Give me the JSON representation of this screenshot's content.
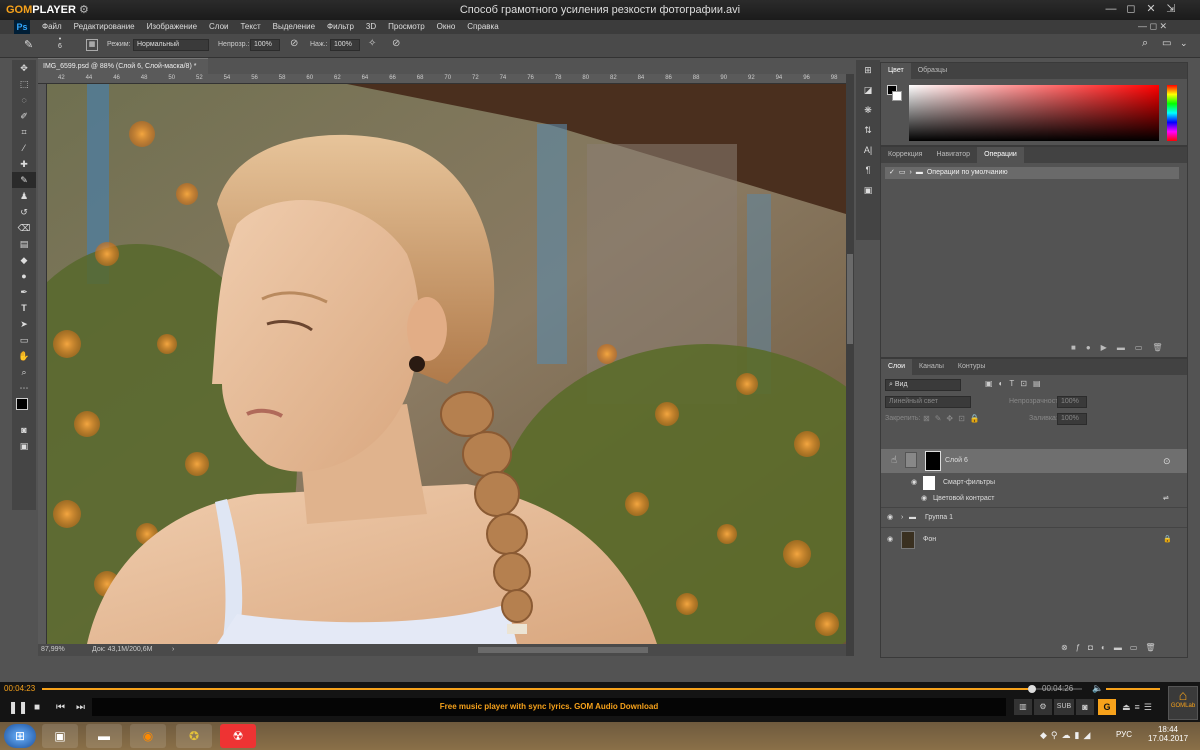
{
  "gom": {
    "logo_a": "GOM",
    "logo_b": "PLAYER",
    "settings_icon": "gear-icon",
    "title": "Способ грамотного усиления резкости фотографии.avi",
    "win_buttons": [
      "—",
      "◻",
      "✕",
      "⇲"
    ]
  },
  "ps": {
    "logo": "Ps",
    "menu": [
      "Файл",
      "Редактирование",
      "Изображение",
      "Слои",
      "Текст",
      "Выделение",
      "Фильтр",
      "3D",
      "Просмотр",
      "Окно",
      "Справка"
    ],
    "options": {
      "brush_size": "6",
      "mode_label": "Режим:",
      "mode_value": "Нормальный",
      "opacity_label": "Непрозр.:",
      "opacity_value": "100%",
      "flow_label": "Наж.:",
      "flow_value": "100%"
    },
    "doc_tab": "IMG_6599.psd @ 88% (Слой 6, Слой-маска/8) *",
    "ruler_ticks": [
      "42",
      "44",
      "46",
      "48",
      "50",
      "52",
      "54",
      "56",
      "58",
      "60",
      "62",
      "64",
      "66",
      "68",
      "70",
      "72",
      "74",
      "76",
      "78",
      "80",
      "82",
      "84",
      "86",
      "88",
      "90",
      "92",
      "94",
      "96",
      "98"
    ],
    "status": {
      "zoom": "87,99%",
      "doc": "Док: 43,1M/200,6M"
    }
  },
  "color_panel": {
    "tabs": [
      "Цвет",
      "Образцы"
    ]
  },
  "actions_panel": {
    "tabs": [
      "Коррекция",
      "Навигатор",
      "Операции"
    ],
    "items": [
      "Операции по умолчанию"
    ]
  },
  "layers_panel": {
    "tabs": [
      "Слои",
      "Каналы",
      "Контуры"
    ],
    "filter": "Вид",
    "blend": "Линейный свет",
    "opacity_label": "Непрозрачность:",
    "opacity_value": "100%",
    "lock_label": "Закрепить:",
    "fill_label": "Заливка:",
    "fill_value": "100%",
    "layers": [
      "Слой 6",
      "Смарт-фильтры",
      "Цветовой контраст",
      "Группа 1",
      "Фон"
    ]
  },
  "player": {
    "time_current": "00:04:23",
    "time_total": "00:04:26",
    "ticker": "Free music player with sync lyrics. GOM Audio Download",
    "buttons": [
      "SUB",
      "G"
    ],
    "badge": "GOMLab"
  },
  "taskbar": {
    "lang": "РУС",
    "time": "18:44",
    "date": "17.04.2017"
  }
}
